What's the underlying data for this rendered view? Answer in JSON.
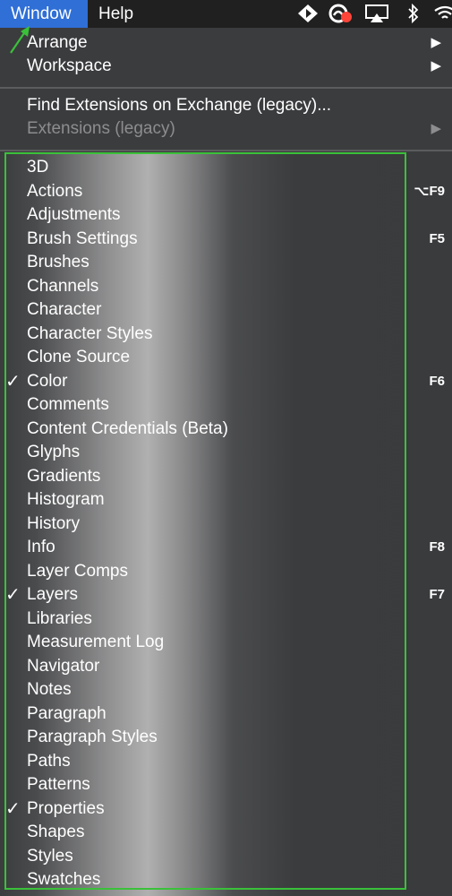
{
  "menubar": {
    "window_label": "Window",
    "help_label": "Help",
    "tray_icons": [
      "diamond-app-icon",
      "cloud-sync-icon",
      "airplay-icon",
      "bluetooth-icon",
      "wifi-icon"
    ]
  },
  "menu": {
    "top_items": [
      {
        "label": "Arrange",
        "submenu": true
      },
      {
        "label": "Workspace",
        "submenu": true
      }
    ],
    "extension_items": [
      {
        "label": "Find Extensions on Exchange (legacy)...",
        "enabled": true
      },
      {
        "label": "Extensions (legacy)",
        "enabled": false,
        "submenu": true
      }
    ],
    "panel_items": [
      {
        "label": "3D",
        "checked": false,
        "shortcut": ""
      },
      {
        "label": "Actions",
        "checked": false,
        "shortcut": "⌥F9"
      },
      {
        "label": "Adjustments",
        "checked": false,
        "shortcut": ""
      },
      {
        "label": "Brush Settings",
        "checked": false,
        "shortcut": "F5"
      },
      {
        "label": "Brushes",
        "checked": false,
        "shortcut": ""
      },
      {
        "label": "Channels",
        "checked": false,
        "shortcut": ""
      },
      {
        "label": "Character",
        "checked": false,
        "shortcut": ""
      },
      {
        "label": "Character Styles",
        "checked": false,
        "shortcut": ""
      },
      {
        "label": "Clone Source",
        "checked": false,
        "shortcut": ""
      },
      {
        "label": "Color",
        "checked": true,
        "shortcut": "F6"
      },
      {
        "label": "Comments",
        "checked": false,
        "shortcut": ""
      },
      {
        "label": "Content Credentials (Beta)",
        "checked": false,
        "shortcut": ""
      },
      {
        "label": "Glyphs",
        "checked": false,
        "shortcut": ""
      },
      {
        "label": "Gradients",
        "checked": false,
        "shortcut": ""
      },
      {
        "label": "Histogram",
        "checked": false,
        "shortcut": ""
      },
      {
        "label": "History",
        "checked": false,
        "shortcut": ""
      },
      {
        "label": "Info",
        "checked": false,
        "shortcut": "F8"
      },
      {
        "label": "Layer Comps",
        "checked": false,
        "shortcut": ""
      },
      {
        "label": "Layers",
        "checked": true,
        "shortcut": "F7"
      },
      {
        "label": "Libraries",
        "checked": false,
        "shortcut": ""
      },
      {
        "label": "Measurement Log",
        "checked": false,
        "shortcut": ""
      },
      {
        "label": "Navigator",
        "checked": false,
        "shortcut": ""
      },
      {
        "label": "Notes",
        "checked": false,
        "shortcut": ""
      },
      {
        "label": "Paragraph",
        "checked": false,
        "shortcut": ""
      },
      {
        "label": "Paragraph Styles",
        "checked": false,
        "shortcut": ""
      },
      {
        "label": "Paths",
        "checked": false,
        "shortcut": ""
      },
      {
        "label": "Patterns",
        "checked": false,
        "shortcut": ""
      },
      {
        "label": "Properties",
        "checked": true,
        "shortcut": ""
      },
      {
        "label": "Shapes",
        "checked": false,
        "shortcut": ""
      },
      {
        "label": "Styles",
        "checked": false,
        "shortcut": ""
      },
      {
        "label": "Swatches",
        "checked": false,
        "shortcut": ""
      }
    ],
    "check_glyph": "✓",
    "submenu_glyph": "▶"
  },
  "colors": {
    "highlight_box": "#3ac13a",
    "menubar_active": "#2f6fd6"
  }
}
